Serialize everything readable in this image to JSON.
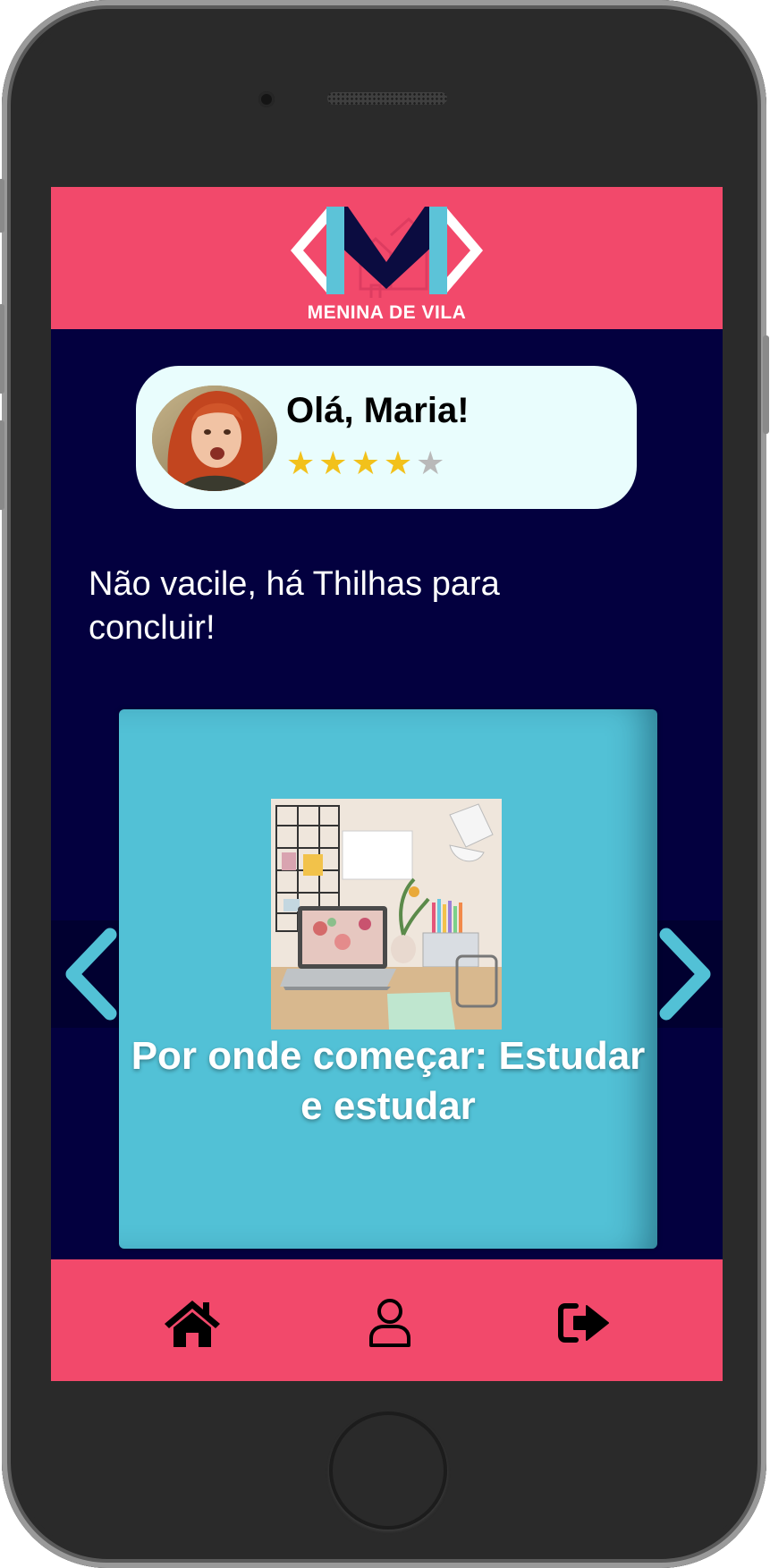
{
  "app": {
    "brand": "MENINA DE VILA",
    "colors": {
      "primary": "#f2496b",
      "background": "#03003f",
      "accent": "#52c1d6",
      "star": "#f2c11b"
    }
  },
  "greeting": {
    "title": "Olá, Maria!",
    "rating": {
      "value": 4,
      "max": 5
    }
  },
  "tagline": "Não vacile, há Thilhas para concluir!",
  "carousel": {
    "card_title": "Por onde começar: Estudar e estudar",
    "prev_icon": "chevron-left-icon",
    "next_icon": "chevron-right-icon"
  },
  "nav": {
    "items": [
      {
        "icon": "home-icon"
      },
      {
        "icon": "user-icon"
      },
      {
        "icon": "logout-icon"
      }
    ]
  }
}
